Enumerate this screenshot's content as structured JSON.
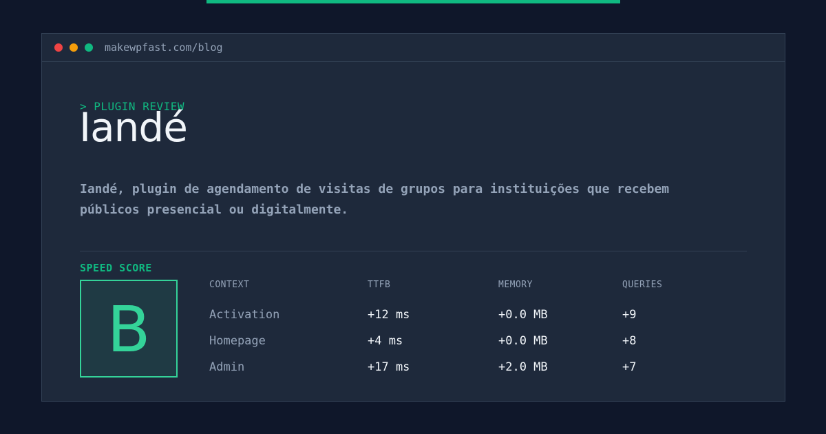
{
  "browser": {
    "url": "makewpfast.com/blog"
  },
  "hero": {
    "eyebrow": "> PLUGIN REVIEW",
    "title": "Iandé",
    "description": "Iandé, plugin de agendamento de visitas de grupos para instituições que recebem públicos presencial ou digitalmente."
  },
  "speed": {
    "label": "SPEED SCORE",
    "grade": "B"
  },
  "metrics": {
    "headers": [
      "CONTEXT",
      "TTFB",
      "MEMORY",
      "QUERIES"
    ],
    "rows": [
      [
        "Activation",
        "+12 ms",
        "+0.0 MB",
        "+9"
      ],
      [
        "Homepage",
        "+4 ms",
        "+0.0 MB",
        "+8"
      ],
      [
        "Admin",
        "+17 ms",
        "+2.0 MB",
        "+7"
      ]
    ]
  },
  "colors": {
    "accent": "#10b981",
    "grade": "#34d399",
    "background": "#0f172a",
    "panel": "#1e293b"
  }
}
